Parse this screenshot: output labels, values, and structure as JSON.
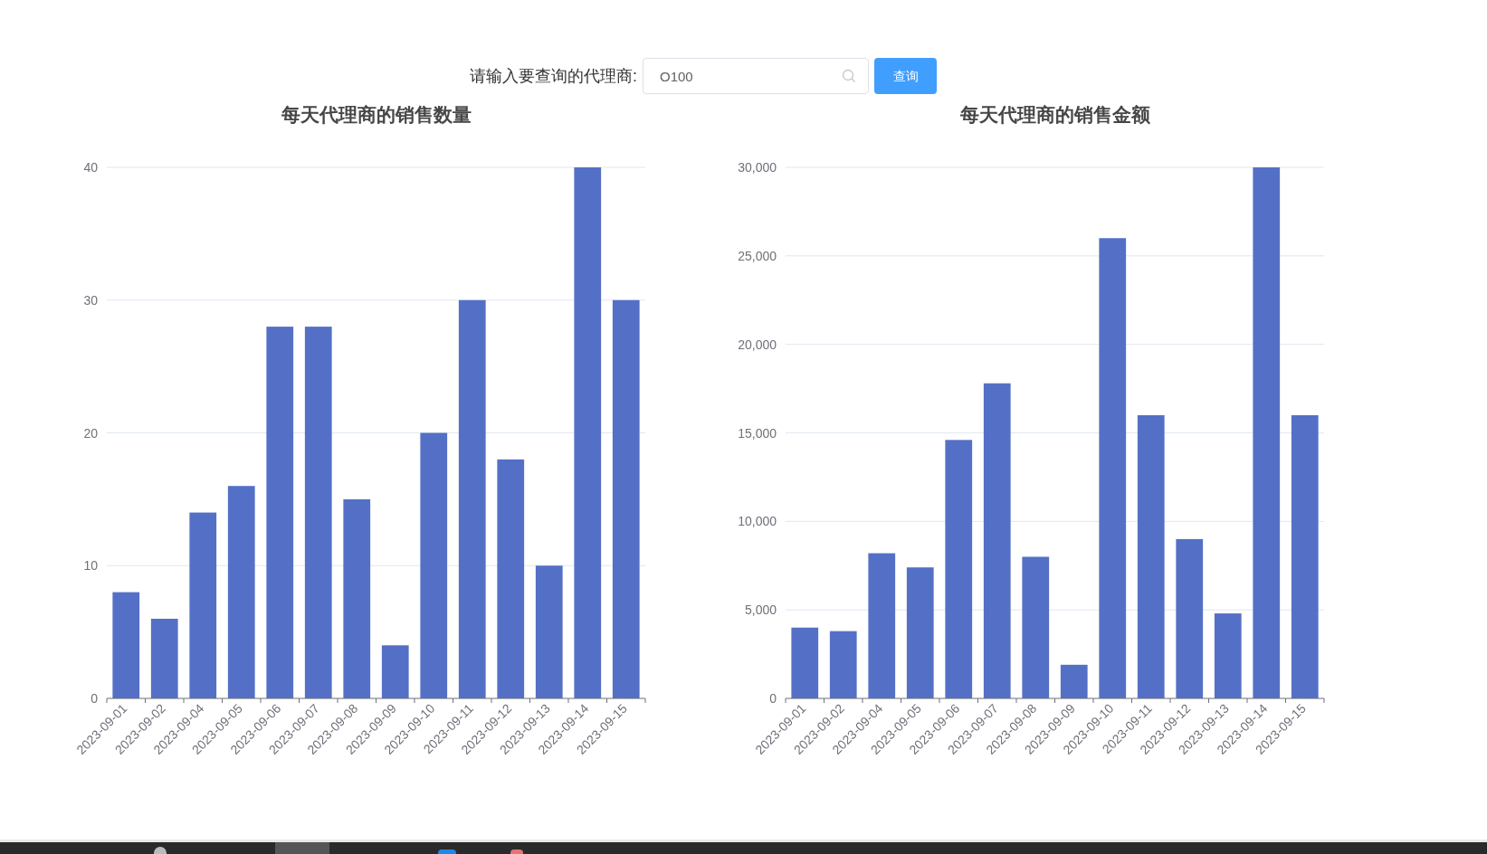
{
  "search": {
    "label": "请输入要查询的代理商:",
    "value": "O100",
    "button": "查询"
  },
  "charts": [
    {
      "chart_data": {
        "type": "bar",
        "title": "每天代理商的销售数量",
        "categories": [
          "2023-09-01",
          "2023-09-02",
          "2023-09-04",
          "2023-09-05",
          "2023-09-06",
          "2023-09-07",
          "2023-09-08",
          "2023-09-09",
          "2023-09-10",
          "2023-09-11",
          "2023-09-12",
          "2023-09-13",
          "2023-09-14",
          "2023-09-15"
        ],
        "values": [
          8,
          6,
          14,
          16,
          28,
          28,
          15,
          4,
          20,
          30,
          18,
          10,
          40,
          30
        ],
        "grid": true,
        "ylim": [
          0,
          40
        ],
        "yticks": [
          0,
          10,
          20,
          30,
          40
        ]
      }
    },
    {
      "chart_data": {
        "type": "bar",
        "title": "每天代理商的销售金额",
        "categories": [
          "2023-09-01",
          "2023-09-02",
          "2023-09-04",
          "2023-09-05",
          "2023-09-06",
          "2023-09-07",
          "2023-09-08",
          "2023-09-09",
          "2023-09-10",
          "2023-09-11",
          "2023-09-12",
          "2023-09-13",
          "2023-09-14",
          "2023-09-15"
        ],
        "values": [
          4000,
          3800,
          8200,
          7400,
          14600,
          17800,
          8000,
          1900,
          26000,
          16000,
          9000,
          4800,
          30000,
          16000
        ],
        "grid": true,
        "ylim": [
          0,
          30000
        ],
        "yticks": [
          {
            "value": 0,
            "label": "0"
          },
          {
            "value": 5000,
            "label": "5,000"
          },
          {
            "value": 10000,
            "label": "10,000"
          },
          {
            "value": 15000,
            "label": "15,000"
          },
          {
            "value": 20000,
            "label": "20,000"
          },
          {
            "value": 25000,
            "label": "25,000"
          },
          {
            "value": 30000,
            "label": "30,000"
          }
        ]
      }
    }
  ]
}
